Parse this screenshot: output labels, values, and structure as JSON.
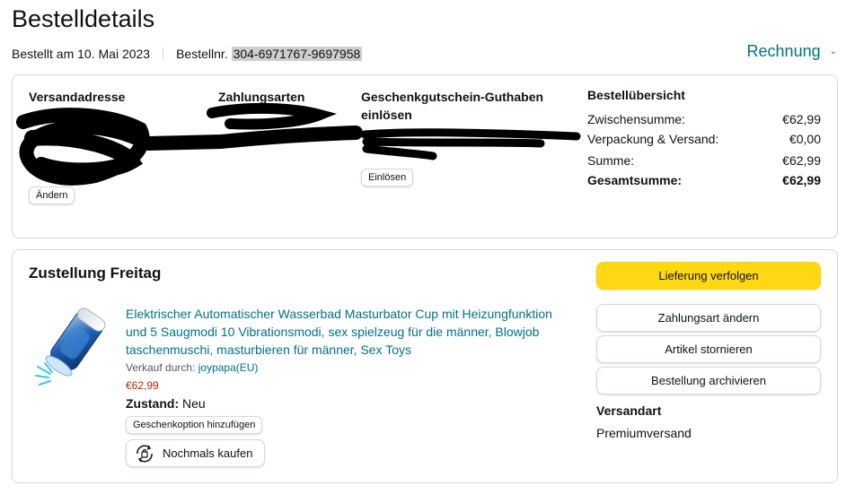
{
  "page": {
    "title": "Bestelldetails",
    "ordered_on": "Bestellt am 10. Mai 2023",
    "order_number_label": "Bestellnr.",
    "order_number": "304-6971767-9697958",
    "invoice_label": "Rechnung"
  },
  "info": {
    "shipping_address_head": "Versandadresse",
    "payment_head": "Zahlungsarten",
    "gift_card_head": "Geschenkgutschein-Guthaben einlösen",
    "change_label": "Ändern",
    "redeem_label": "Einlösen"
  },
  "summary": {
    "title": "Bestellübersicht",
    "rows": [
      {
        "label": "Zwischensumme:",
        "value": "€62,99"
      },
      {
        "label": "Verpackung & Versand:",
        "value": "€0,00"
      },
      {
        "label": "Summe:",
        "value": "€62,99"
      },
      {
        "label": "Gesamtsumme:",
        "value": "€62,99"
      }
    ]
  },
  "delivery": {
    "title": "Zustellung Freitag",
    "product_title": "Elektrischer Automatischer Wasserbad Masturbator Cup mit Heizungfunktion und 5 Saugmodi 10 Vibrationsmodi, sex spielzeug für die männer, Blowjob taschenmuschi, masturbieren für männer, Sex Toys",
    "sold_by_label": "Verkauf durch:",
    "seller": "joypapa(EU)",
    "price": "€62,99",
    "condition_label": "Zustand:",
    "condition_value": "Neu",
    "gift_option_label": "Geschenkoption hinzufügen",
    "buy_again_label": "Nochmals kaufen"
  },
  "actions": {
    "track": "Lieferung verfolgen",
    "change_payment": "Zahlungsart ändern",
    "cancel": "Artikel stornieren",
    "archive": "Bestellung archivieren"
  },
  "shipping": {
    "head": "Versandart",
    "value": "Premiumversand"
  },
  "colors": {
    "link": "#007185",
    "price": "#b12704",
    "primary_button": "#ffd814",
    "border": "#d5d9d9"
  }
}
